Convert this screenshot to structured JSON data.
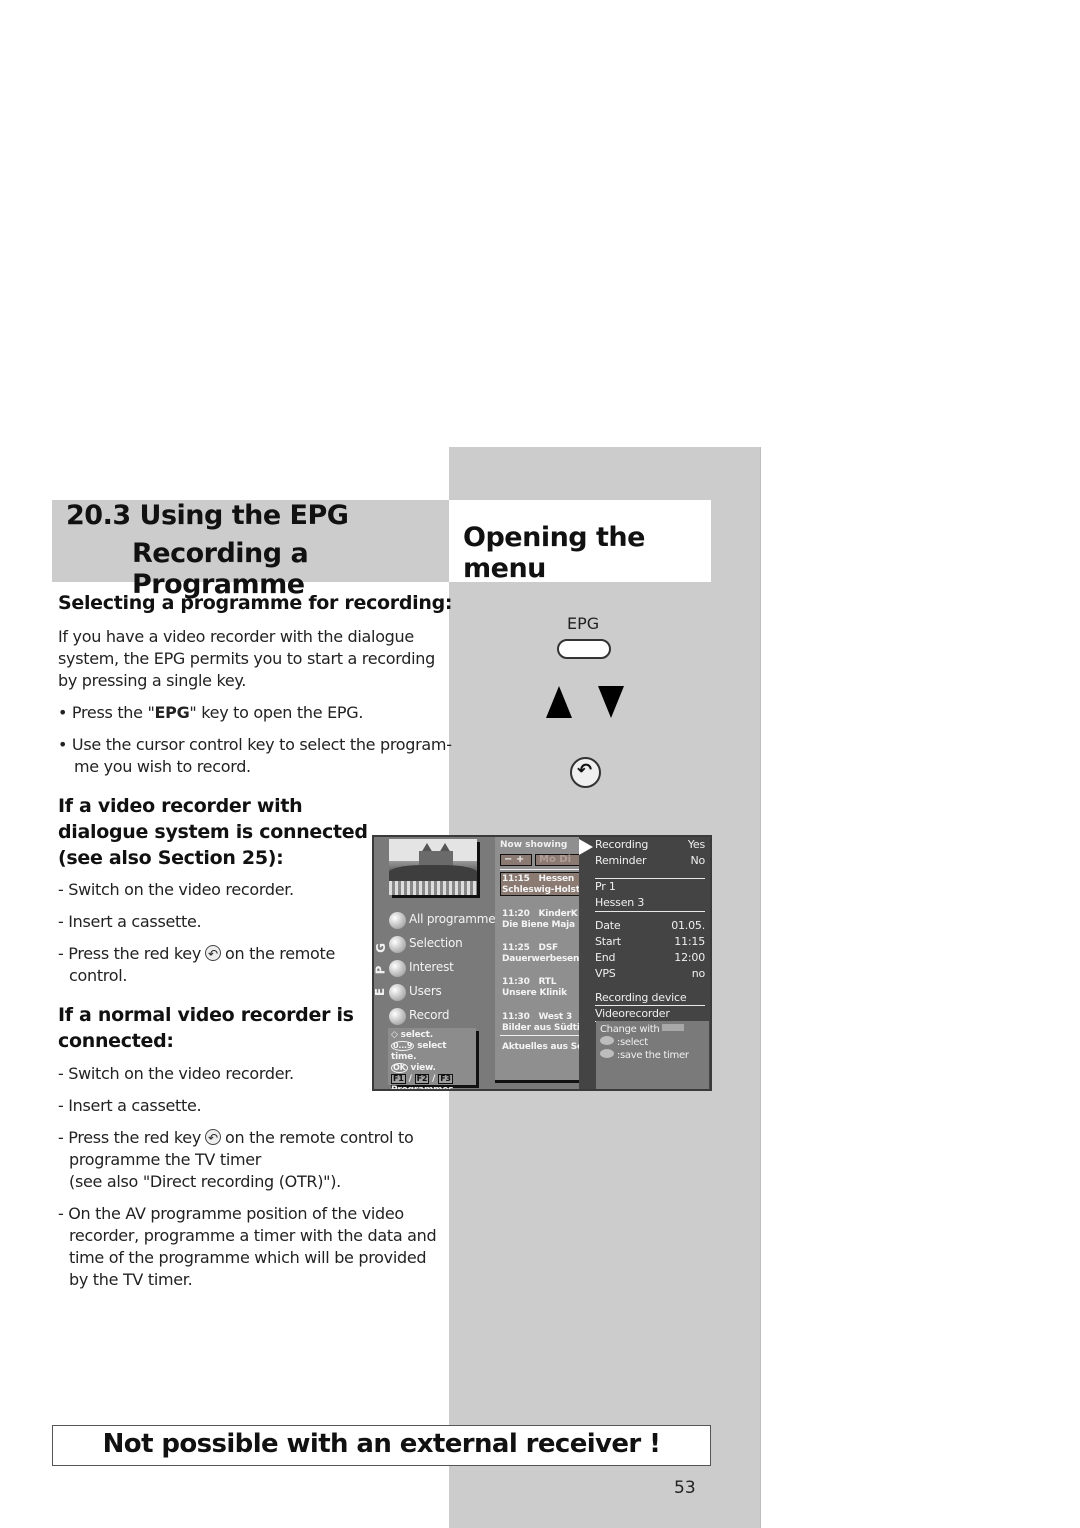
{
  "section": {
    "number_title": "20.3 Using the EPG",
    "subtitle": "Recording a Programme"
  },
  "side_panel": {
    "title": "Opening the menu",
    "epg_key_label": "EPG",
    "icons": [
      "epg-button",
      "arrow-up",
      "arrow-down",
      "record-back-key"
    ]
  },
  "content": {
    "heading1": "Selecting a programme for recording:",
    "intro_lines": [
      "If you have a video recorder with the dialogue",
      "system, the EPG permits you to start a recording",
      "by pressing a single key."
    ],
    "bullet1_pre": "• Press the \"",
    "bullet1_bold": "EPG",
    "bullet1_post": "\" key to open the EPG.",
    "bullet2_line1": "• Use the cursor control key to select the program-",
    "bullet2_line2": "me you wish to record.",
    "heading2_lines": [
      "If a video recorder with",
      "dialogue system is connected",
      "(see also Section 25):"
    ],
    "dialogue_steps": {
      "step1": "- Switch on the video recorder.",
      "step2": "- Insert a cassette.",
      "step3_pre": "- Press the red key",
      "step3_post": "on the remote",
      "step3_line2": "control."
    },
    "heading3_lines": [
      "If a normal video recorder is",
      "connected:"
    ],
    "normal_steps": {
      "step1": "- Switch on the video recorder.",
      "step2": "- Insert a cassette.",
      "step3_pre": "- Press the red key",
      "step3_post": "on the remote control to",
      "step3_line2": "programme the TV timer",
      "step3_line3": "(see also \"Direct recording (OTR)\").",
      "step4_lines": [
        "- On the AV programme position of the video",
        "recorder, programme a timer with the data and",
        "time of the programme which will be provided",
        "by the TV timer."
      ]
    }
  },
  "epg_screen": {
    "vertical_label": [
      "E",
      "P",
      "G"
    ],
    "menu": [
      "All programmes",
      "Selection",
      "Interest",
      "Users",
      "Record"
    ],
    "help": {
      "line1": "select.",
      "line2_keys": "0...9",
      "line2": "select time.",
      "line3_key": "OK",
      "line3": "view.",
      "fkeys": [
        "F1",
        "F2",
        "F3"
      ],
      "line5": "Programmes select."
    },
    "list": {
      "header": "Now showing",
      "minus_plus": "−  +",
      "days": "Mo Di",
      "programmes": [
        {
          "time": "11:15",
          "channel": "Hessen",
          "title": "Schleswig-Holstein"
        },
        {
          "time": "11:20",
          "channel": "KinderK",
          "title": "Die Biene Maja"
        },
        {
          "time": "11:25",
          "channel": "DSF",
          "title": "Dauerwerbesendung"
        },
        {
          "time": "11:30",
          "channel": "RTL",
          "title": "Unsere Klinik"
        },
        {
          "time": "11:30",
          "channel": "West 3",
          "title": "Bilder aus Südtirol"
        }
      ],
      "extra": "Aktuelles aus Schleswig"
    },
    "panel": {
      "recording_label": "Recording",
      "recording_value": "Yes",
      "reminder_label": "Reminder",
      "reminder_value": "No",
      "pr_label": "Pr   1",
      "channel": "Hessen 3",
      "date_label": "Date",
      "date_value": "01.05.",
      "start_label": "Start",
      "start_value": "11:15",
      "end_label": "End",
      "end_value": "12:00",
      "vps_label": "VPS",
      "vps_value": "no",
      "device_label": "Recording device",
      "device_value": "Videorecorder",
      "help_change": "Change with",
      "help_select": ":select",
      "help_save": ":save the timer"
    }
  },
  "notice": "Not possible with an external receiver !",
  "page_number": "53"
}
